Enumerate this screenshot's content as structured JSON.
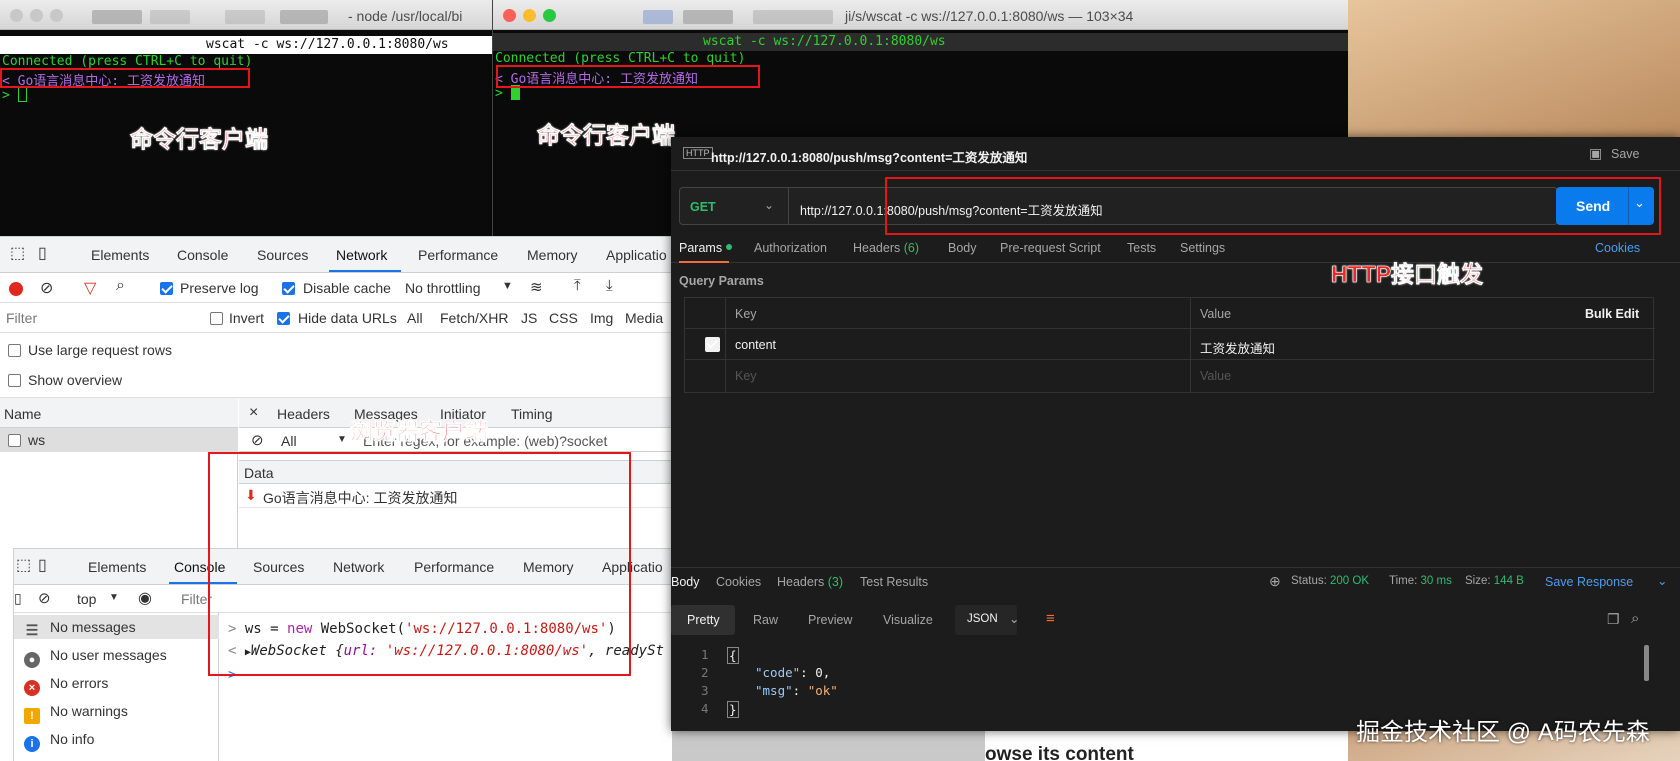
{
  "term_left": {
    "title": "- node /usr/local/bi",
    "command": "wscat -c ws://127.0.0.1:8080/ws",
    "connected": "Connected (press CTRL+C to quit)",
    "message": "< Go语言消息中心: 工资发放通知",
    "prompt": ">",
    "annotation": "命令行客户端"
  },
  "term_right": {
    "title": "ji/s/wscat -c ws://127.0.0.1:8080/ws — 103×34",
    "command": "wscat -c ws://127.0.0.1:8080/ws",
    "connected": "Connected (press CTRL+C to quit)",
    "message": "< Go语言消息中心: 工资发放通知",
    "prompt": ">",
    "annotation": "命令行客户端"
  },
  "devtools": {
    "tabs": [
      "Elements",
      "Console",
      "Sources",
      "Network",
      "Performance",
      "Memory",
      "Applicatio"
    ],
    "active_tab": "Network",
    "toolbar": {
      "preserve_log": "Preserve log",
      "disable_cache": "Disable cache",
      "throttling": "No throttling"
    },
    "filter_bar": {
      "placeholder": "Filter",
      "invert": "Invert",
      "hide_data_urls": "Hide data URLs",
      "types": [
        "All",
        "Fetch/XHR",
        "JS",
        "CSS",
        "Img",
        "Media"
      ]
    },
    "large_rows": "Use large request rows",
    "show_overview": "Show overview",
    "name_header": "Name",
    "request": "ws",
    "detail_tabs": [
      "Headers",
      "Messages",
      "Initiator",
      "Timing"
    ],
    "msg_filter_type": "All",
    "msg_filter_placeholder": "Enter regex, for example: (web)?socket",
    "data_header": "Data",
    "message": "Go语言消息中心: 工资发放通知",
    "annotation": "浏览器客户端"
  },
  "console": {
    "tabs": [
      "Elements",
      "Console",
      "Sources",
      "Network",
      "Performance",
      "Memory",
      "Applicatio"
    ],
    "active_tab": "Console",
    "context": "top",
    "filter_placeholder": "Filter",
    "sidebar": [
      "No messages",
      "No user messages",
      "No errors",
      "No warnings",
      "No info"
    ],
    "line1_prompt": ">",
    "line1_var": "ws",
    "line1_eq": " = ",
    "line1_new": "new",
    "line1_cls": " WebSocket(",
    "line1_str": "'ws://127.0.0.1:8080/ws'",
    "line1_end": ")",
    "line2_prompt": "<",
    "line2_obj": "WebSocket {",
    "line2_key": "url: ",
    "line2_val": "'ws://127.0.0.1:8080/ws'",
    "line2_rest": ", readySt",
    "line3_prompt": ">"
  },
  "postman": {
    "title": "http://127.0.0.1:8080/push/msg?content=工资发放通知",
    "save": "Save",
    "method": "GET",
    "url": "http://127.0.0.1:8080/push/msg?content=工资发放通知",
    "send": "Send",
    "tabs": [
      "Params",
      "Authorization",
      "Headers",
      "Body",
      "Pre-request Script",
      "Tests",
      "Settings"
    ],
    "headers_count": "(6)",
    "cookies": "Cookies",
    "query_params": "Query Params",
    "col_key": "Key",
    "col_value": "Value",
    "bulk_edit": "Bulk Edit",
    "param_key": "content",
    "param_value": "工资发放通知",
    "key_placeholder": "Key",
    "value_placeholder": "Value",
    "annotation": "HTTP接口触发",
    "resp_tabs": [
      "Body",
      "Cookies",
      "Headers",
      "Test Results"
    ],
    "resp_headers_count": "(3)",
    "status_label": "Status:",
    "status_value": "200 OK",
    "time_label": "Time:",
    "time_value": "30 ms",
    "size_label": "Size:",
    "size_value": "144 B",
    "save_response": "Save Response",
    "view_tabs": [
      "Pretty",
      "Raw",
      "Preview",
      "Visualize"
    ],
    "format": "JSON",
    "code_lines": [
      "1",
      "2",
      "3",
      "4"
    ],
    "code_key1": "\"code\"",
    "code_val1": " 0,",
    "code_key2": "\"msg\"",
    "code_val2": " \"ok\"",
    "brace_open": "{",
    "brace_close": "}"
  },
  "article_text": "owse its content",
  "watermark": "掘金技术社区 @ A码农先森",
  "colors": {
    "annotation_red": "#f02525",
    "send_blue": "#097bed",
    "status_green": "#2dbd6e",
    "terminal_green": "#2fd12f",
    "terminal_purple": "#b26ce6"
  }
}
